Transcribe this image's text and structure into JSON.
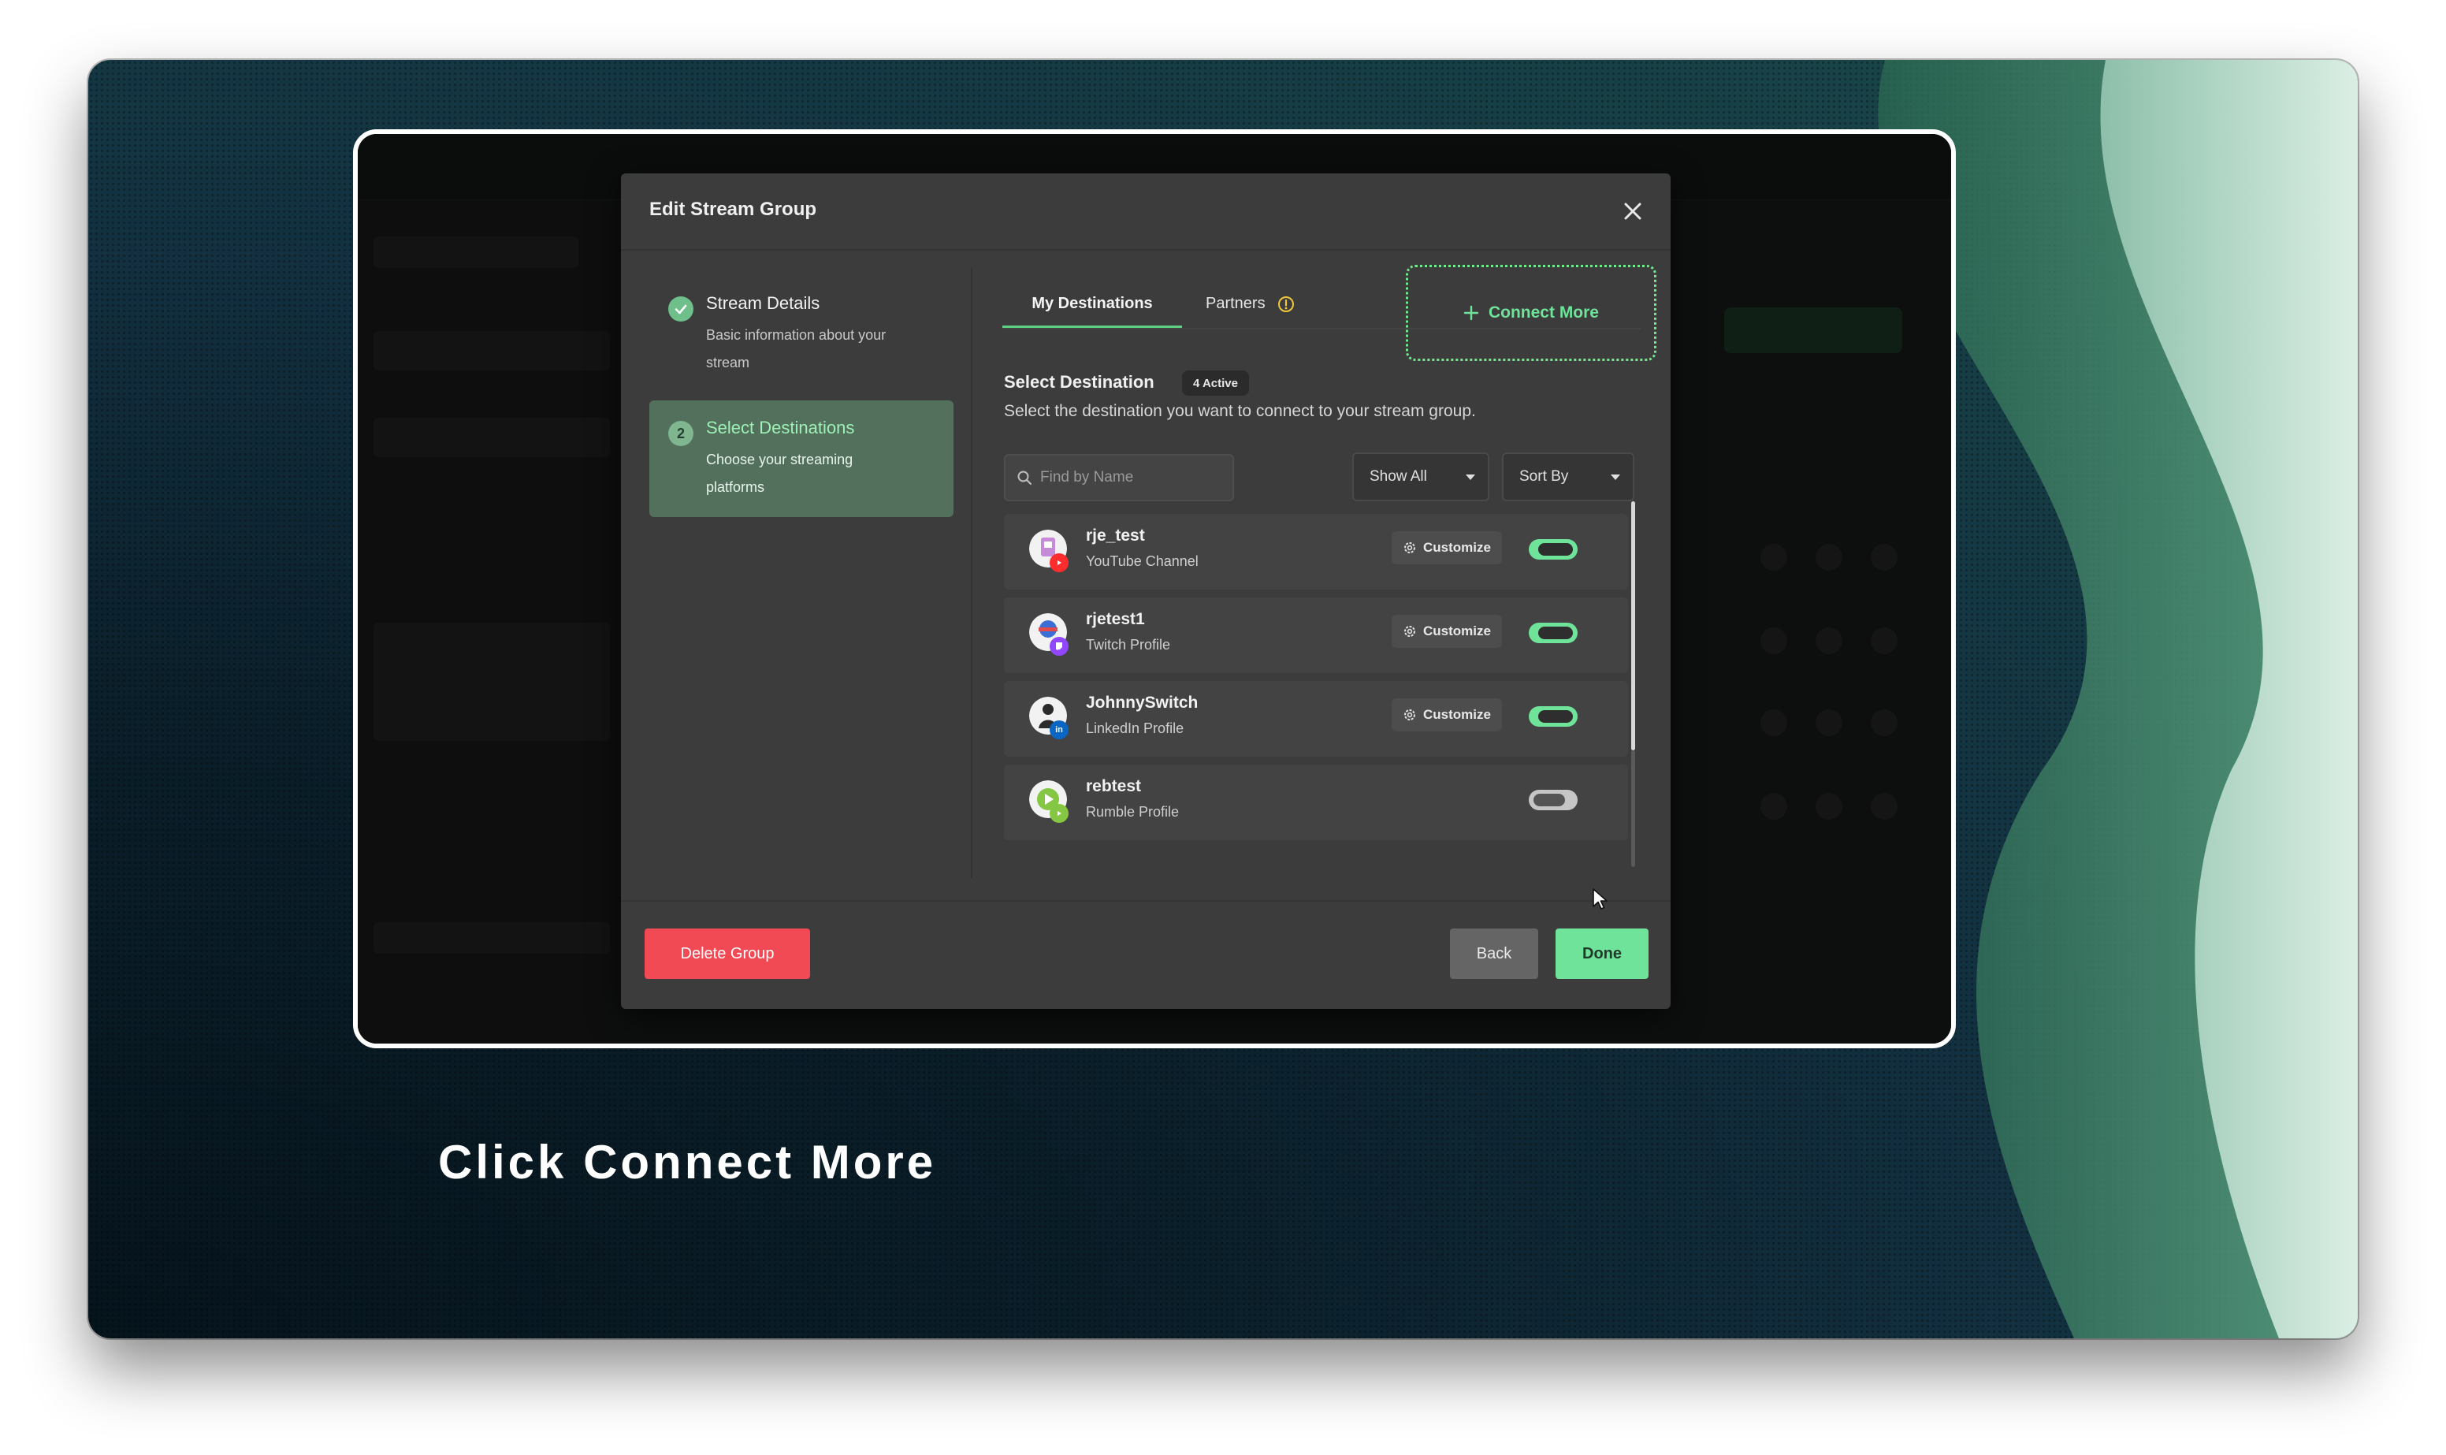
{
  "modal": {
    "title": "Edit Stream Group",
    "close_icon": "close-icon"
  },
  "steps": [
    {
      "title": "Stream Details",
      "desc_line1": "Basic information about your",
      "desc_line2": "stream",
      "status": "completed",
      "icon": "check-icon"
    },
    {
      "number": "2",
      "title": "Select Destinations",
      "desc_line1": "Choose your streaming",
      "desc_line2": "platforms",
      "status": "active"
    }
  ],
  "tabs": {
    "my_destinations": "My Destinations",
    "partners": "Partners",
    "partners_icon": "info-icon"
  },
  "connect_more": {
    "label": "Connect More",
    "icon": "plus-icon"
  },
  "select": {
    "title": "Select Destination",
    "badge": "4 Active",
    "subtitle": "Select the destination you want to connect to your stream group."
  },
  "search": {
    "placeholder": "Find by Name",
    "icon": "search-icon"
  },
  "filters": {
    "show": "Show All",
    "sort": "Sort By"
  },
  "destinations": [
    {
      "name": "rje_test",
      "type": "YouTube Channel",
      "platform": "youtube",
      "customize": "Customize",
      "enabled": true
    },
    {
      "name": "rjetest1",
      "type": "Twitch Profile",
      "platform": "twitch",
      "customize": "Customize",
      "enabled": true
    },
    {
      "name": "JohnnySwitch",
      "type": "LinkedIn Profile",
      "platform": "linkedin",
      "customize": "Customize",
      "enabled": true
    },
    {
      "name": "rebtest",
      "type": "Rumble Profile",
      "platform": "rumble",
      "enabled": false
    }
  ],
  "footer": {
    "delete": "Delete Group",
    "back": "Back",
    "done": "Done"
  },
  "colors": {
    "accent_green": "#6fe39a",
    "danger_red": "#f24a55",
    "modal_bg": "#3c3c3c"
  },
  "caption": "Click Connect More"
}
